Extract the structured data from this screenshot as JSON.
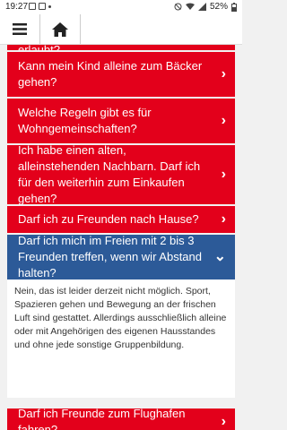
{
  "status": {
    "time": "19:27",
    "battery": "52%"
  },
  "toolbar": {
    "menu_icon": "hamburger-menu-icon",
    "home_icon": "home-icon"
  },
  "faq": {
    "cut_item": "Ist Musik und Instrumente spielen erlaubt?",
    "items": [
      "Kann mein Kind alleine zum Bäcker gehen?",
      "Welche Regeln gibt es für Wohngemeinschaften?",
      "Ich habe einen alten, alleinstehenden Nachbarn. Darf ich für den weiterhin zum Einkaufen gehen?",
      "Darf ich zu Freunden nach Hause?",
      "Darf ich mich im Freien mit 2 bis 3 Freunden treffen, wenn wir Abstand halten?",
      "Darf ich Freunde zum Flughafen fahren?"
    ],
    "answer": "Nein, das ist leider derzeit nicht möglich. Sport, Spazieren gehen und Bewegung an der frischen Luft sind gestattet. Allerdings ausschließlich alleine oder mit Angehörigen des eigenen Hausstandes und ohne jede sonstige Gruppenbildung."
  },
  "colors": {
    "item_red": "#e3001b",
    "item_open_blue": "#2c5a98"
  }
}
